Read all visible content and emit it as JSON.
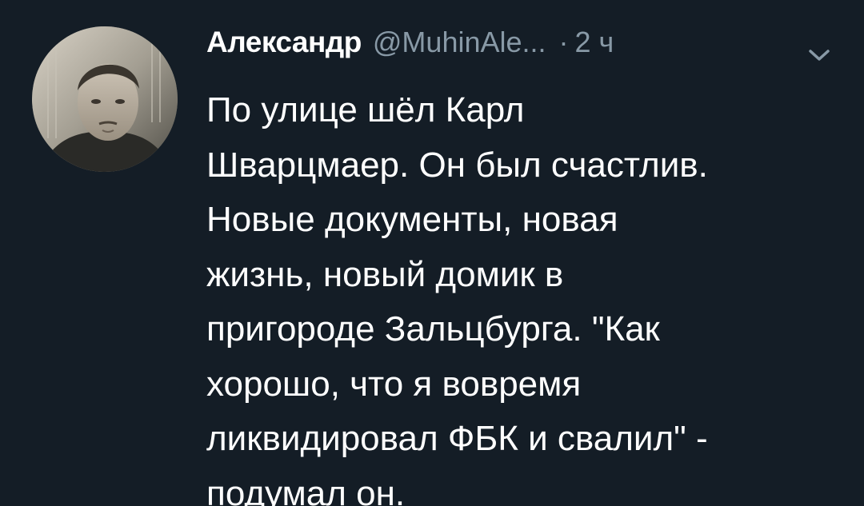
{
  "tweet": {
    "author_name": "Александр",
    "author_handle": "@MuhinAle...",
    "separator": "·",
    "time": "2 ч",
    "text_lines": [
      "По улице шёл Карл",
      "Шварцмаер. Он был счастлив.",
      "Новые документы, новая",
      "жизнь, новый домик в",
      "пригороде Зальцбурга. \"Как",
      "хорошо, что я вовремя",
      "ликвидировал ФБК и свалил\" -",
      "подумал он."
    ]
  },
  "icons": {
    "avatar": "avatar-photo",
    "menu": "chevron-down-icon"
  },
  "colors": {
    "background": "#141d26",
    "text": "#ffffff",
    "secondary": "#8899a6"
  }
}
